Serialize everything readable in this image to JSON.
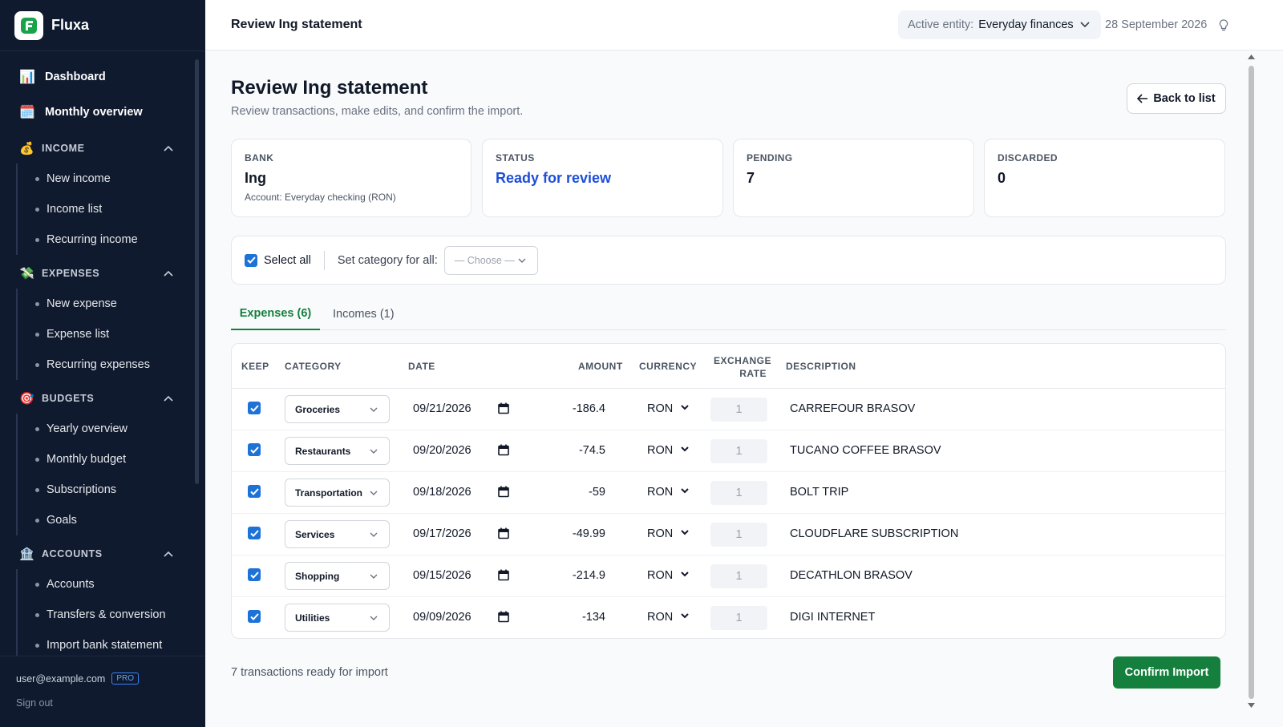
{
  "app": {
    "name": "Fluxa"
  },
  "sidebar": {
    "top_items": [
      {
        "label": "Dashboard",
        "icon": "📊"
      },
      {
        "label": "Monthly overview",
        "icon": "🗓️"
      }
    ],
    "sections": [
      {
        "title": "INCOME",
        "icon": "💰",
        "items": [
          "New income",
          "Income list",
          "Recurring income"
        ]
      },
      {
        "title": "EXPENSES",
        "icon": "💸",
        "items": [
          "New expense",
          "Expense list",
          "Recurring expenses"
        ]
      },
      {
        "title": "BUDGETS",
        "icon": "🎯",
        "items": [
          "Yearly overview",
          "Monthly budget",
          "Subscriptions",
          "Goals"
        ]
      },
      {
        "title": "ACCOUNTS",
        "icon": "🏦",
        "items": [
          "Accounts",
          "Transfers & conversion",
          "Import bank statement"
        ]
      }
    ],
    "user_email": "user@example.com",
    "plan_badge": "PRO",
    "sign_out": "Sign out"
  },
  "topbar": {
    "title": "Review Ing statement",
    "entity_label": "Active entity:",
    "entity_value": "Everyday finances",
    "date": "28 September 2026"
  },
  "page": {
    "title": "Review Ing statement",
    "subtitle": "Review transactions, make edits, and confirm the import.",
    "back_button": "Back to list"
  },
  "cards": {
    "bank": {
      "label": "BANK",
      "value": "Ing",
      "note": "Account: Everyday checking (RON)"
    },
    "status": {
      "label": "STATUS",
      "value": "Ready for review"
    },
    "pending": {
      "label": "PENDING",
      "value": "7"
    },
    "discarded": {
      "label": "DISCARDED",
      "value": "0"
    }
  },
  "toolbar": {
    "select_all": "Select all",
    "set_category_label": "Set category for all:",
    "choose_placeholder": "— Choose —"
  },
  "tabs": [
    {
      "label": "Expenses (6)",
      "active": true
    },
    {
      "label": "Incomes (1)",
      "active": false
    }
  ],
  "table": {
    "headers": {
      "keep": "KEEP",
      "category": "CATEGORY",
      "date": "DATE",
      "amount": "AMOUNT",
      "currency": "CURRENCY",
      "exchange_rate_1": "EXCHANGE",
      "exchange_rate_2": "RATE",
      "description": "DESCRIPTION"
    },
    "rows": [
      {
        "keep": true,
        "category": "Groceries",
        "date": "09/21/2026",
        "amount": "-186.4",
        "currency": "RON",
        "rate": "1",
        "description": "CARREFOUR BRASOV"
      },
      {
        "keep": true,
        "category": "Restaurants",
        "date": "09/20/2026",
        "amount": "-74.5",
        "currency": "RON",
        "rate": "1",
        "description": "TUCANO COFFEE BRASOV"
      },
      {
        "keep": true,
        "category": "Transportation",
        "date": "09/18/2026",
        "amount": "-59",
        "currency": "RON",
        "rate": "1",
        "description": "BOLT TRIP"
      },
      {
        "keep": true,
        "category": "Services",
        "date": "09/17/2026",
        "amount": "-49.99",
        "currency": "RON",
        "rate": "1",
        "description": "CLOUDFLARE SUBSCRIPTION"
      },
      {
        "keep": true,
        "category": "Shopping",
        "date": "09/15/2026",
        "amount": "-214.9",
        "currency": "RON",
        "rate": "1",
        "description": "DECATHLON BRASOV"
      },
      {
        "keep": true,
        "category": "Utilities",
        "date": "09/09/2026",
        "amount": "-134",
        "currency": "RON",
        "rate": "1",
        "description": "DIGI INTERNET"
      }
    ]
  },
  "footer": {
    "summary": "7 transactions ready for import",
    "confirm_button": "Confirm Import"
  },
  "colors": {
    "sidebar_bg": "#0f1a2e",
    "accent_green": "#15803d",
    "status_blue": "#1d4ed8",
    "checkbox_blue": "#1d72d8"
  }
}
